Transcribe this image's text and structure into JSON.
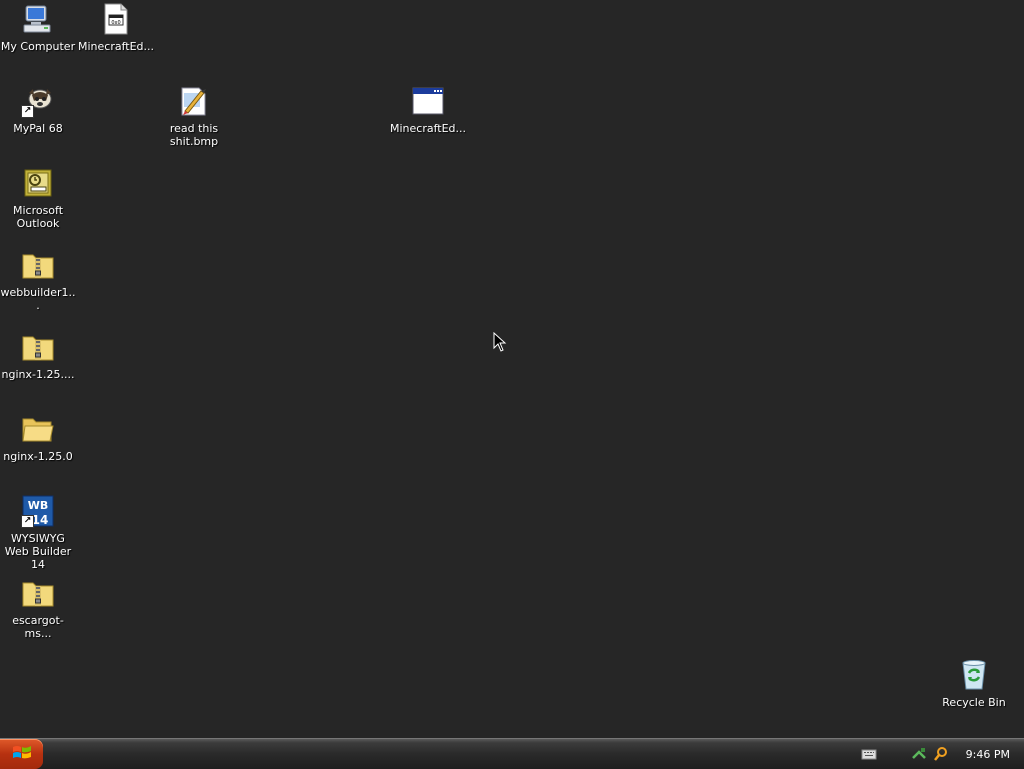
{
  "desktop": {
    "icons": [
      {
        "label": "My Computer",
        "icon": "my-computer-icon"
      },
      {
        "label": "MinecraftEd...",
        "icon": "document-window-icon"
      },
      {
        "label": "MyPal 68",
        "icon": "mypal-browser-icon"
      },
      {
        "label": "read this shit.bmp",
        "icon": "bitmap-paint-icon"
      },
      {
        "label": "MinecraftEd...",
        "icon": "application-window-icon"
      },
      {
        "label": "Microsoft Outlook",
        "icon": "outlook-icon"
      },
      {
        "label": "webbuilder1...",
        "icon": "zip-folder-icon"
      },
      {
        "label": "nginx-1.25....",
        "icon": "zip-folder-icon"
      },
      {
        "label": "nginx-1.25.0",
        "icon": "folder-icon"
      },
      {
        "label": "WYSIWYG Web Builder 14",
        "icon": "webbuilder-icon"
      },
      {
        "label": "escargot-ms...",
        "icon": "zip-folder-icon"
      },
      {
        "label": "Recycle Bin",
        "icon": "recycle-bin-icon"
      }
    ]
  },
  "taskbar": {
    "start_icon": "windows-logo-icon",
    "tray_icons": [
      "keyboard-icon",
      "network-icon",
      "search-icon"
    ],
    "clock": "9:46 PM"
  },
  "colors": {
    "desktop_bg": "#262626",
    "start_button": "#b73110"
  }
}
